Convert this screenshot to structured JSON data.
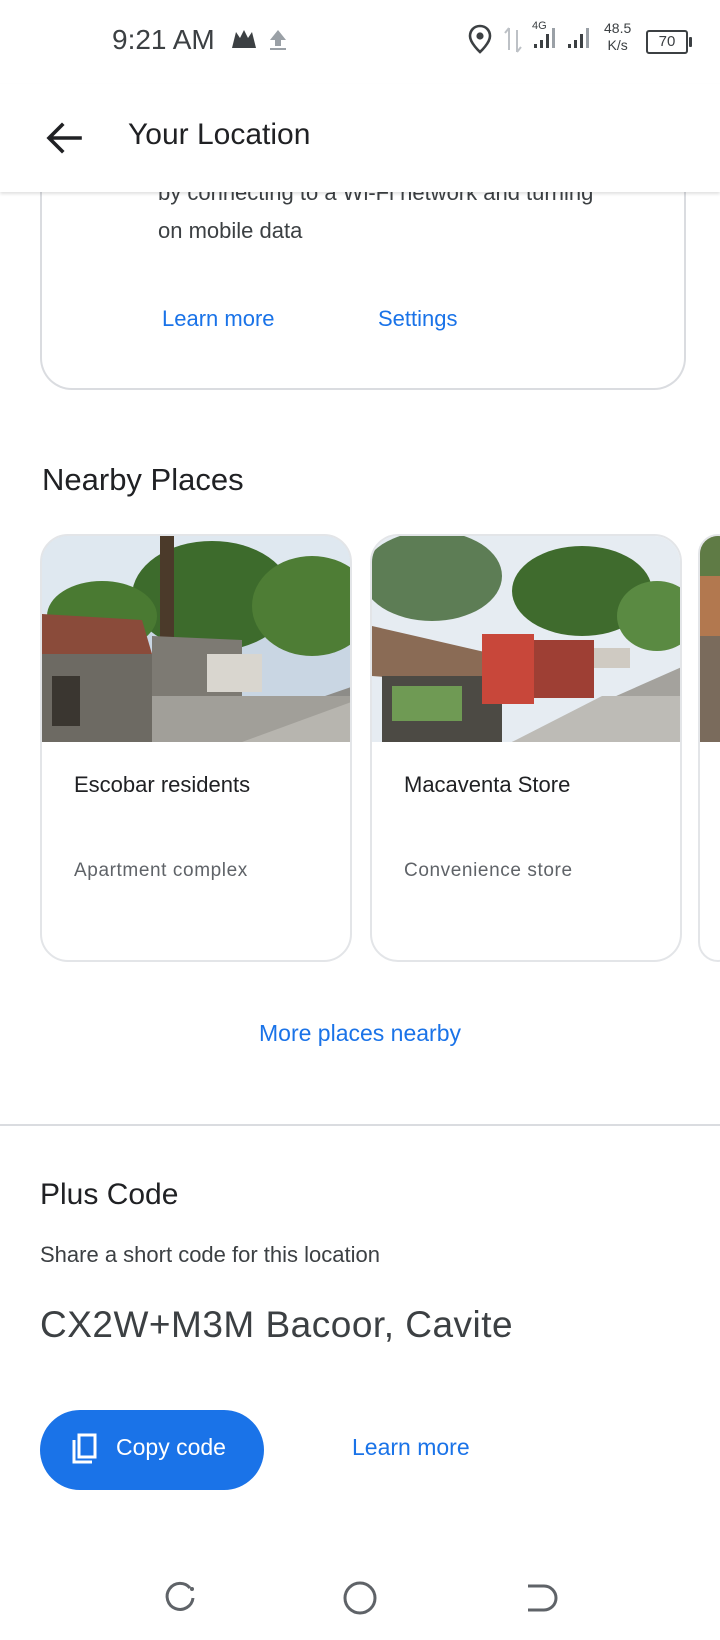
{
  "status_bar": {
    "time": "9:21 AM",
    "network_type": "4G",
    "speed_value": "48.5",
    "speed_unit": "K/s",
    "battery": "70"
  },
  "app_bar": {
    "title": "Your Location"
  },
  "wifi_card": {
    "text_partial": "by connecting to a Wi-Fi network and turning",
    "text": "on mobile data",
    "learn_more": "Learn more",
    "settings": "Settings"
  },
  "nearby": {
    "heading": "Nearby Places",
    "places": [
      {
        "name": "Escobar residents",
        "category": "Apartment complex"
      },
      {
        "name": "Macaventa Store",
        "category": "Convenience store"
      }
    ],
    "more_label": "More places nearby"
  },
  "plus_code": {
    "heading": "Plus Code",
    "subtitle": "Share a short code for this location",
    "code": "CX2W+M3M Bacoor, Cavite",
    "copy_label": "Copy code",
    "learn_more": "Learn more"
  },
  "colors": {
    "accent": "#1a73e8",
    "text_primary": "#202124",
    "text_secondary": "#5f6368",
    "border": "#dadce0"
  },
  "icons": [
    "back-arrow-icon",
    "location-pin-icon",
    "copy-icon",
    "recents-icon",
    "home-icon",
    "back-nav-icon"
  ]
}
